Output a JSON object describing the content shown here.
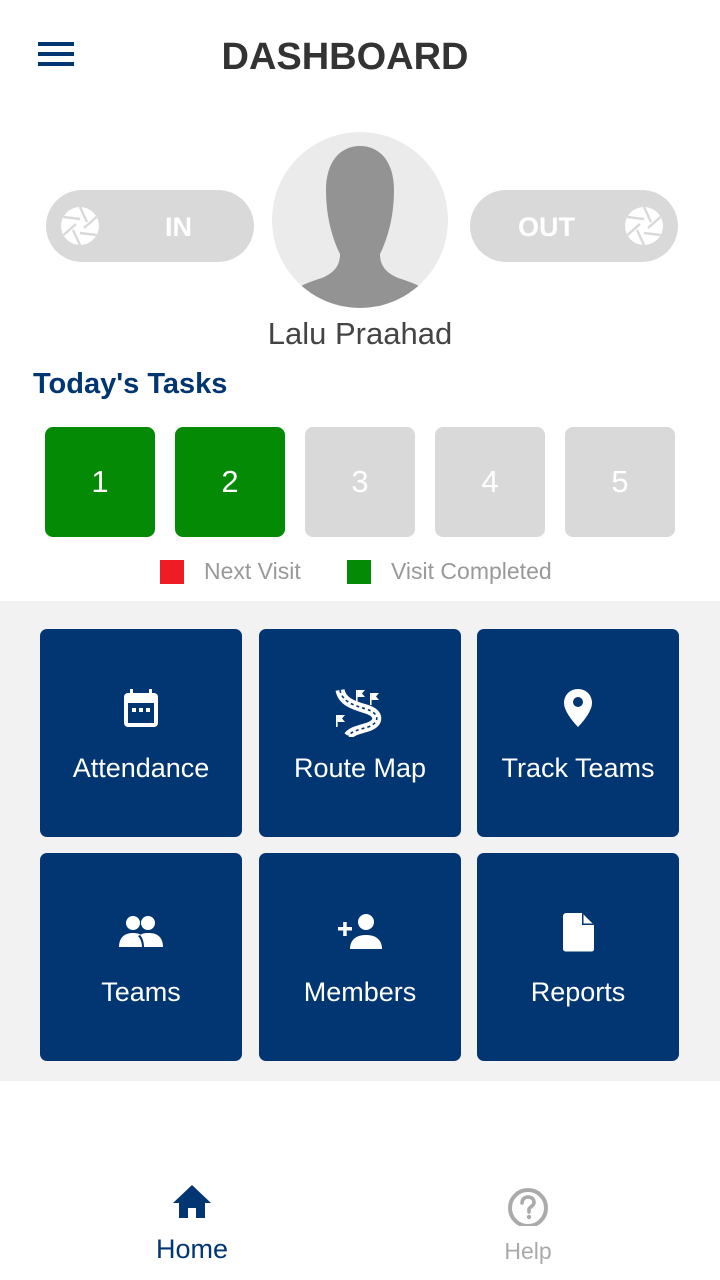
{
  "header": {
    "title": "DASHBOARD",
    "menu_icon": "hamburger-menu-icon"
  },
  "checkin": {
    "in_label": "IN",
    "out_label": "OUT",
    "icon": "camera-shutter-icon"
  },
  "profile": {
    "name": "Lalu Praahad",
    "avatar_icon": "user-silhouette-icon"
  },
  "tasks": {
    "title": "Today's Tasks",
    "items": [
      {
        "label": "1",
        "status": "completed"
      },
      {
        "label": "2",
        "status": "completed"
      },
      {
        "label": "3",
        "status": "pending"
      },
      {
        "label": "4",
        "status": "pending"
      },
      {
        "label": "5",
        "status": "pending"
      }
    ],
    "legend": [
      {
        "label": "Next Visit",
        "color": "#ee1c25"
      },
      {
        "label": "Visit Completed",
        "color": "#058a05"
      }
    ]
  },
  "menu_tiles": [
    {
      "label": "Attendance",
      "icon": "calendar-icon"
    },
    {
      "label": "Route Map",
      "icon": "route-map-icon"
    },
    {
      "label": "Track Teams",
      "icon": "location-pin-icon"
    },
    {
      "label": "Teams",
      "icon": "group-icon"
    },
    {
      "label": "Members",
      "icon": "add-person-icon"
    },
    {
      "label": "Reports",
      "icon": "document-icon"
    }
  ],
  "bottom_nav": {
    "items": [
      {
        "label": "Home",
        "icon": "home-icon",
        "active": true
      },
      {
        "label": "Help",
        "icon": "help-circle-icon",
        "active": false
      }
    ]
  },
  "colors": {
    "brand": "#023672",
    "completed": "#058a05",
    "next_visit": "#ee1c25",
    "pending": "#d9d9d9"
  }
}
